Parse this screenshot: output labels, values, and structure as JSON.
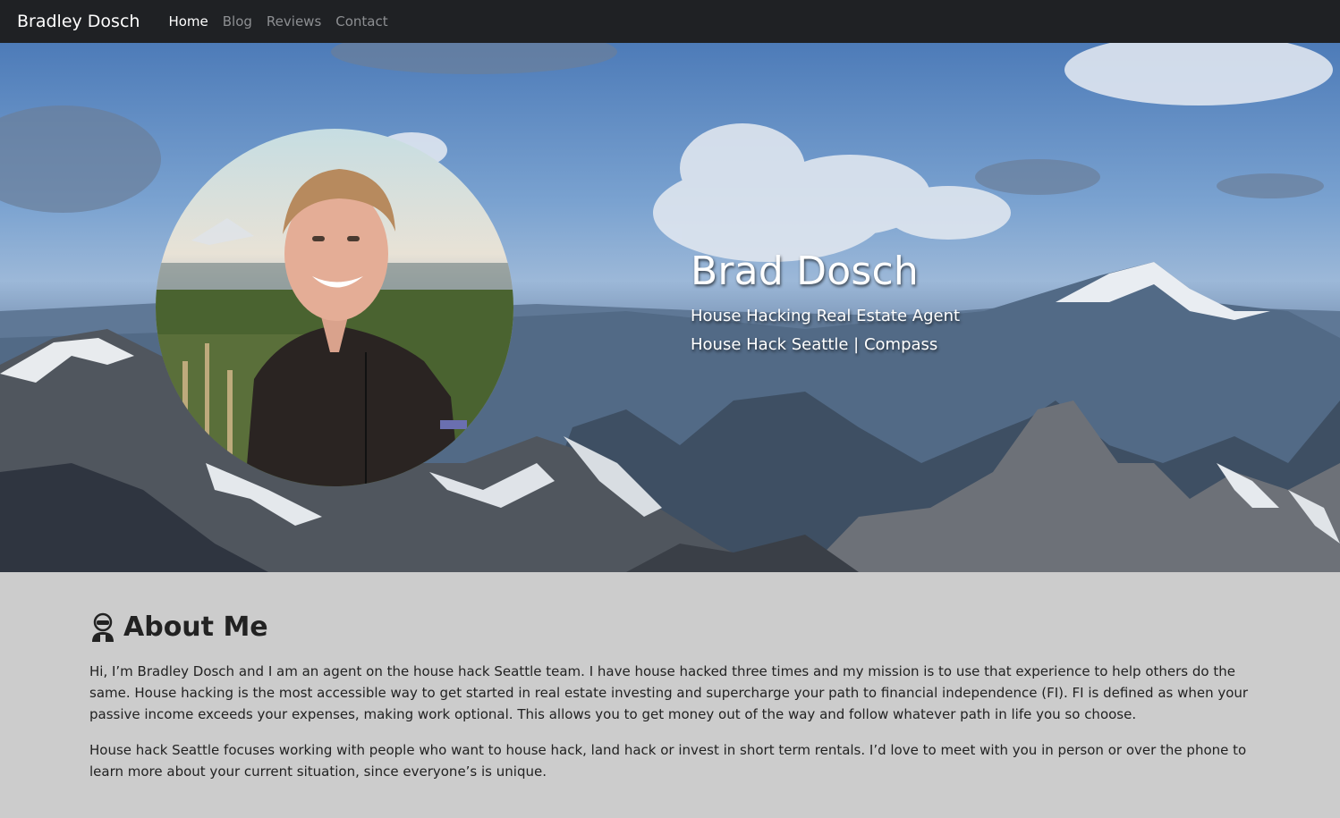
{
  "nav": {
    "brand": "Bradley Dosch",
    "links": [
      {
        "label": "Home",
        "active": true
      },
      {
        "label": "Blog",
        "active": false
      },
      {
        "label": "Reviews",
        "active": false
      },
      {
        "label": "Contact",
        "active": false
      }
    ]
  },
  "hero": {
    "name": "Brad Dosch",
    "subtitle1": "House Hacking Real Estate Agent",
    "subtitle2": "House Hack Seattle | Compass"
  },
  "about": {
    "icon": "user-ninja-icon",
    "title": "About Me",
    "paragraphs": [
      "Hi, I’m Bradley Dosch and I am an agent on the house hack Seattle team. I have house hacked three times and my mission is to use that experience to help others do the same. House hacking is the most accessible way to get started in real estate investing and supercharge your path to financial independence (FI). FI is defined as when your passive income exceeds your expenses, making work optional. This allows you to get money out of the way and follow whatever path in life you so choose.",
      "House hack Seattle focuses working with people who want to house hack, land hack or invest in short term rentals. I’d love to meet with you in person or over the phone to learn more about your current situation, since everyone’s is unique."
    ]
  }
}
